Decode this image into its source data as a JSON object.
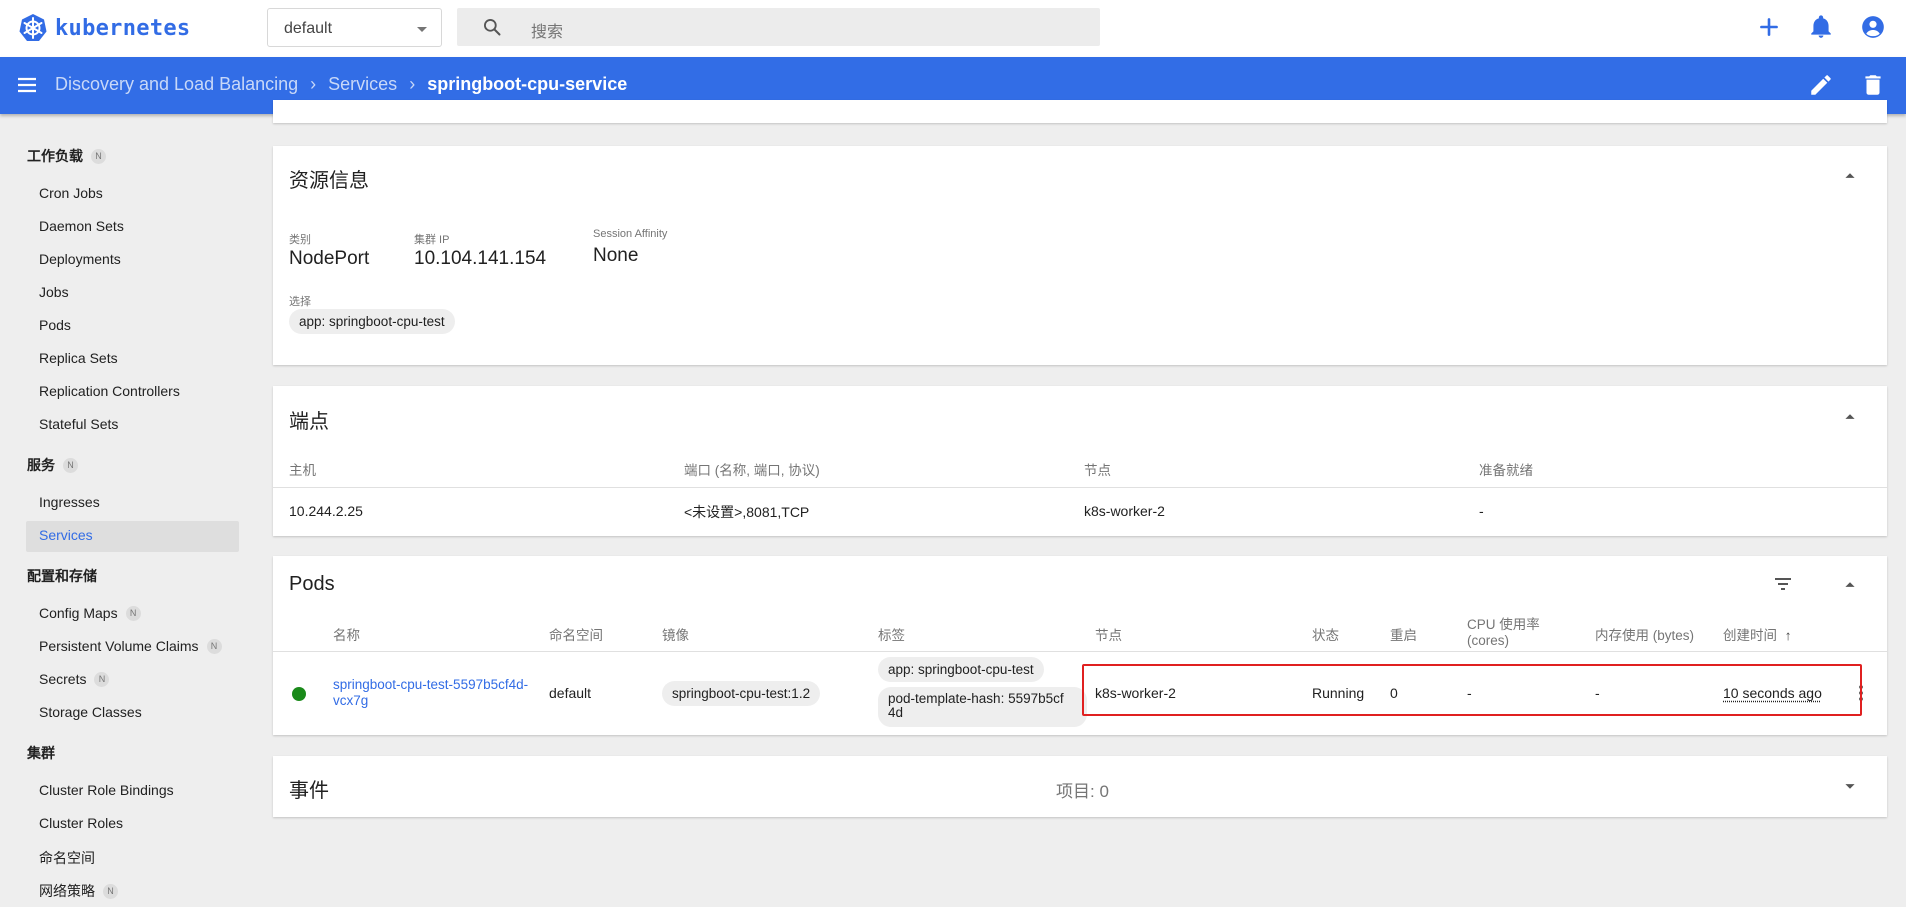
{
  "app": {
    "logo_text": "kubernetes"
  },
  "topbar": {
    "namespace": "default",
    "search_placeholder": "搜索"
  },
  "header": {
    "breadcrumb": [
      "Discovery and Load Balancing",
      "Services",
      "springboot-cpu-service"
    ]
  },
  "sidebar": {
    "sections": [
      {
        "title": "工作负载",
        "badge": "N",
        "items": [
          {
            "label": "Cron Jobs"
          },
          {
            "label": "Daemon Sets"
          },
          {
            "label": "Deployments"
          },
          {
            "label": "Jobs"
          },
          {
            "label": "Pods"
          },
          {
            "label": "Replica Sets"
          },
          {
            "label": "Replication Controllers"
          },
          {
            "label": "Stateful Sets"
          }
        ]
      },
      {
        "title": "服务",
        "badge": "N",
        "items": [
          {
            "label": "Ingresses"
          },
          {
            "label": "Services",
            "active": true
          }
        ]
      },
      {
        "title": "配置和存储",
        "items": [
          {
            "label": "Config Maps",
            "badge": "N"
          },
          {
            "label": "Persistent Volume Claims",
            "badge": "N"
          },
          {
            "label": "Secrets",
            "badge": "N"
          },
          {
            "label": "Storage Classes"
          }
        ]
      },
      {
        "title": "集群",
        "items": [
          {
            "label": "Cluster Role Bindings"
          },
          {
            "label": "Cluster Roles"
          },
          {
            "label": "命名空间"
          },
          {
            "label": "网络策略",
            "badge": "N"
          }
        ]
      }
    ]
  },
  "resource_info": {
    "title": "资源信息",
    "type_label": "类别",
    "type_value": "NodePort",
    "ip_label": "集群 IP",
    "ip_value": "10.104.141.154",
    "affinity_label": "Session Affinity",
    "affinity_value": "None",
    "selector_label": "选择",
    "selector_chip": "app: springboot-cpu-test"
  },
  "endpoints": {
    "title": "端点",
    "headers": [
      "主机",
      "端口 (名称, 端口, 协议)",
      "节点",
      "准备就绪"
    ],
    "rows": [
      [
        "10.244.2.25",
        "<未设置>,8081,TCP",
        "k8s-worker-2",
        "-"
      ]
    ]
  },
  "pods": {
    "title": "Pods",
    "headers": {
      "name": "名称",
      "namespace": "命名空间",
      "image": "镜像",
      "labels": "标签",
      "node": "节点",
      "status": "状态",
      "restarts": "重启",
      "cpu_line1": "CPU 使用率",
      "cpu_line2": "(cores)",
      "memory": "内存使用 (bytes)",
      "created": "创建时间",
      "sort_arrow": "↑"
    },
    "row": {
      "name_line1": "springboot-cpu-test-5597b5cf4d-",
      "name_line2": "vcx7g",
      "namespace": "default",
      "image": "springboot-cpu-test:1.2",
      "label1": "app: springboot-cpu-test",
      "label2_line1": "pod-template-hash: 5597b5cf",
      "label2_line2": "4d",
      "node": "k8s-worker-2",
      "status": "Running",
      "restarts": "0",
      "cpu": "-",
      "memory": "-",
      "created": "10 seconds ago"
    }
  },
  "events": {
    "title": "事件",
    "count_text": "项目: 0"
  },
  "colors": {
    "brand": "#326ce5",
    "header": "#326de6",
    "status_ok": "#1a8a1a",
    "highlight": "#e02020"
  }
}
